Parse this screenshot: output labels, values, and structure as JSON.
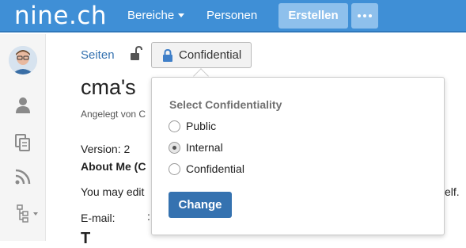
{
  "header": {
    "logo": "nine.ch",
    "nav": [
      {
        "label": "Bereiche",
        "has_caret": true
      },
      {
        "label": "Personen",
        "has_caret": false
      }
    ],
    "create_label": "Erstellen",
    "more_icon": "ellipsis-icon"
  },
  "sidebar": {
    "icons": [
      "user-avatar",
      "person-icon",
      "pages-icon",
      "rss-icon",
      "tree-icon"
    ]
  },
  "breadcrumb": {
    "label": "Seiten"
  },
  "confidentiality_button": {
    "label": "Confidential",
    "icon": "lock-icon"
  },
  "page": {
    "title": "cma's",
    "created_by": "Angelegt von C",
    "version": "Version: 2",
    "about": "About Me (C",
    "may_edit": "You may edit",
    "may_edit_tail": "elf.",
    "email_label": "E-mail:",
    "email_value": ":",
    "section_heading": "T"
  },
  "popup": {
    "title": "Select Confidentiality",
    "options": [
      {
        "label": "Public",
        "checked": false
      },
      {
        "label": "Internal",
        "checked": true
      },
      {
        "label": "Confidential",
        "checked": false
      }
    ],
    "button_label": "Change"
  },
  "colors": {
    "header_bg": "#3f8fd6",
    "link": "#3572b0",
    "primary_button": "#3572b0"
  }
}
